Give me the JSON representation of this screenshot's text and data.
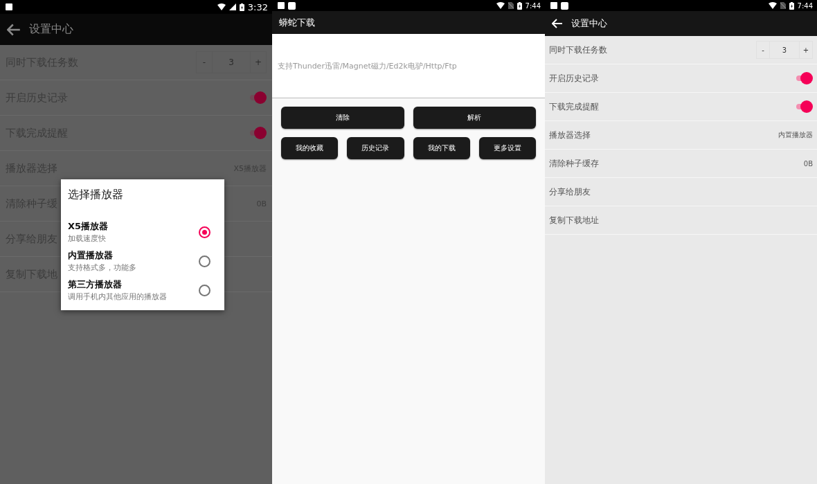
{
  "screens": [
    {
      "kind": "settings",
      "status_bar": {
        "time": "3:32"
      },
      "title": "设置中心",
      "rows": [
        {
          "kind": "stepper",
          "label": "同时下载任务数",
          "minus": "-",
          "value": "3",
          "plus": "+"
        },
        {
          "kind": "switch",
          "label": "开启历史记录",
          "on": true
        },
        {
          "kind": "switch",
          "label": "下载完成提醒",
          "on": true
        },
        {
          "kind": "value",
          "label": "播放器选择",
          "value": "X5播放器"
        },
        {
          "kind": "value",
          "label": "清除种子缓",
          "value": "0B"
        },
        {
          "kind": "plain",
          "label": "分享给朋友"
        },
        {
          "kind": "plain",
          "label": "复制下载地"
        }
      ],
      "dialog": {
        "title": "选择播放器",
        "options": [
          {
            "name": "X5播放器",
            "description": "加载速度快",
            "selected": true
          },
          {
            "name": "内置播放器",
            "description": "支持格式多，功能多",
            "selected": false
          },
          {
            "name": "第三方播放器",
            "description": "调用手机内其他应用的播放器",
            "selected": false
          }
        ]
      }
    },
    {
      "kind": "home",
      "status_bar": {
        "time": "7:44"
      },
      "title": "蟒蛇下载",
      "link_field": {
        "placeholder": "支持Thunder迅雷/Magnet磁力/Ed2k电驴/Http/Ftp"
      },
      "button_rows": [
        [
          "清除",
          "解析"
        ],
        [
          "我的收藏",
          "历史记录",
          "我的下载",
          "更多设置"
        ]
      ]
    },
    {
      "kind": "settings",
      "status_bar": {
        "time": "7:44"
      },
      "title": "设置中心",
      "rows": [
        {
          "kind": "stepper",
          "label": "同时下载任务数",
          "minus": "-",
          "value": "3",
          "plus": "+"
        },
        {
          "kind": "switch",
          "label": "开启历史记录",
          "on": true
        },
        {
          "kind": "switch",
          "label": "下载完成提醒",
          "on": true
        },
        {
          "kind": "value",
          "label": "播放器选择",
          "value": "内置播放器"
        },
        {
          "kind": "value",
          "label": "清除种子缓存",
          "value": "0B"
        },
        {
          "kind": "plain",
          "label": "分享给朋友"
        },
        {
          "kind": "plain",
          "label": "复制下载地址"
        }
      ]
    }
  ]
}
